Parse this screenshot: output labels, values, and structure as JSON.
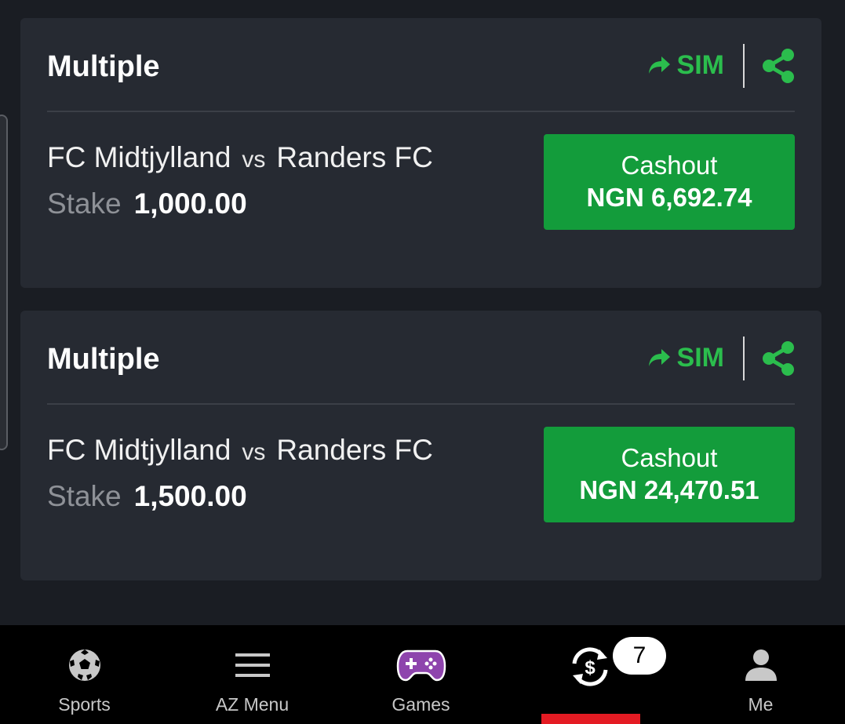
{
  "bets": [
    {
      "title": "Multiple",
      "sim_label": "SIM",
      "home": "FC Midtjylland",
      "vs": "vs",
      "away": "Randers FC",
      "stake_label": "Stake",
      "stake_amount": "1,000.00",
      "cashout_label": "Cashout",
      "cashout_amount": "NGN 6,692.74"
    },
    {
      "title": "Multiple",
      "sim_label": "SIM",
      "home": "FC Midtjylland",
      "vs": "vs",
      "away": "Randers FC",
      "stake_label": "Stake",
      "stake_amount": "1,500.00",
      "cashout_label": "Cashout",
      "cashout_amount": "NGN 24,470.51"
    }
  ],
  "nav": {
    "items": [
      {
        "label": "Sports",
        "icon": "soccer-ball-icon"
      },
      {
        "label": "AZ Menu",
        "icon": "menu-icon"
      },
      {
        "label": "Games",
        "icon": "gamepad-icon"
      },
      {
        "label": "",
        "icon": "cashout-icon"
      },
      {
        "label": "Me",
        "icon": "user-icon"
      }
    ],
    "cashout_badge": "7"
  },
  "colors": {
    "accent_green": "#2bbd4d",
    "cashout_button": "#139c3b",
    "active_indicator": "#e41b23",
    "games_icon": "#8e44ad"
  }
}
